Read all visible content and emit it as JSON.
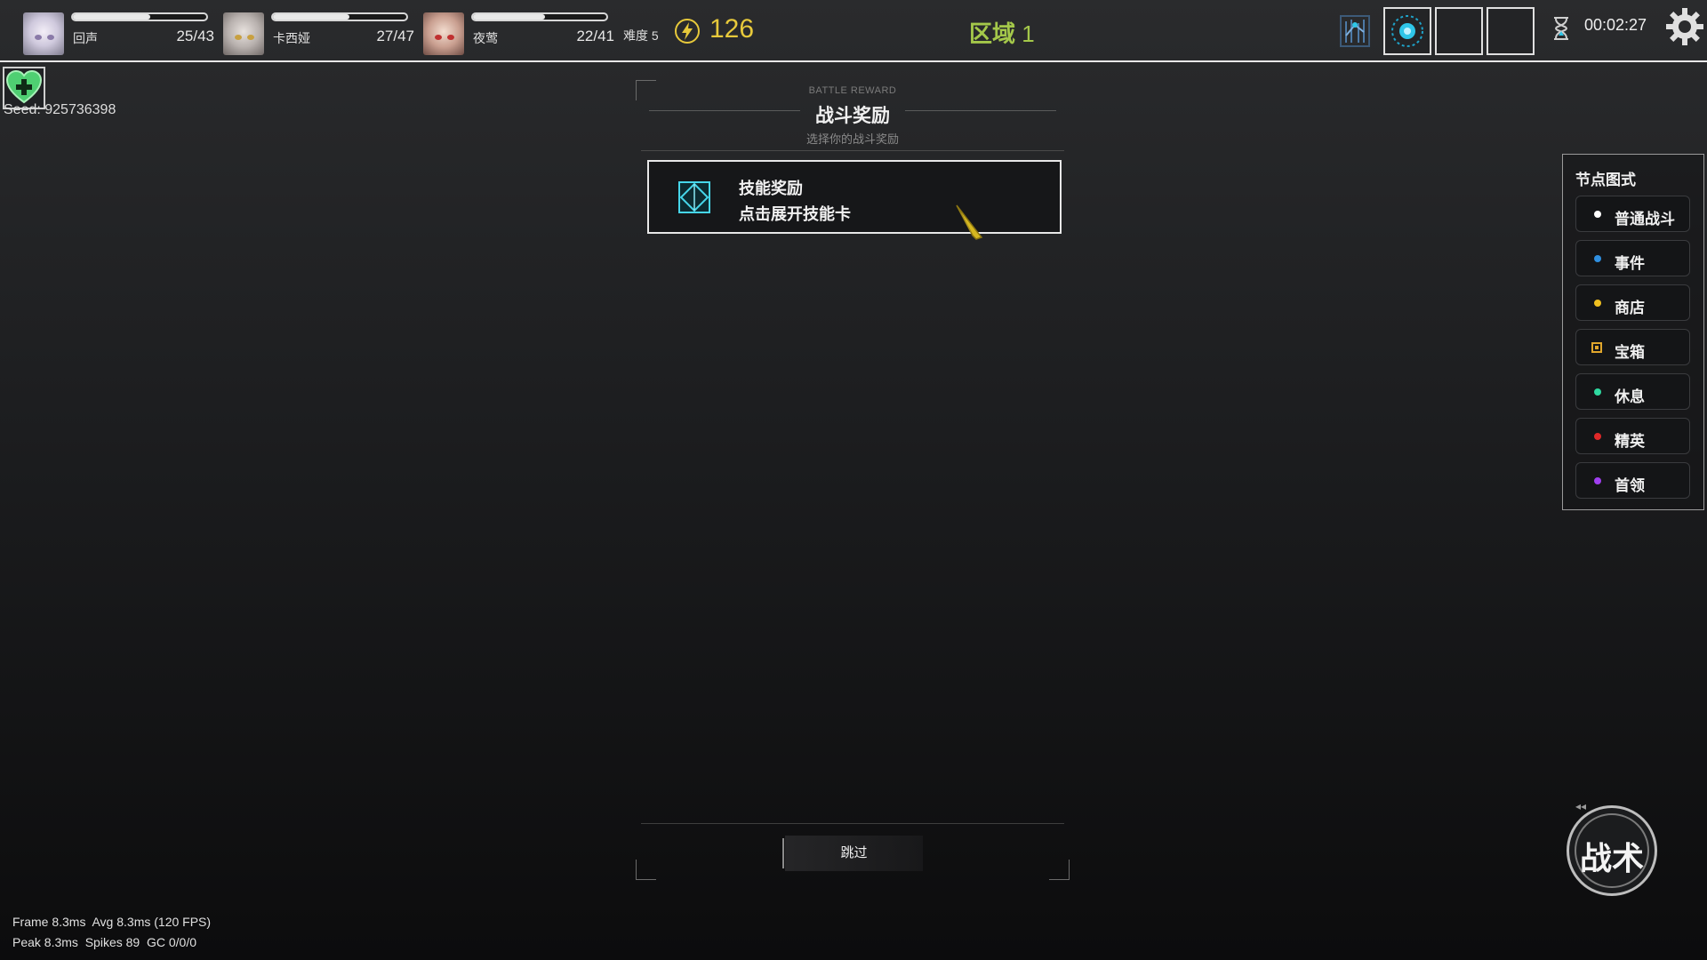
{
  "party": [
    {
      "name": "回声",
      "hp": "25/43",
      "hp_fraction": 0.58,
      "portrait_color": "#c9c6d8"
    },
    {
      "name": "卡西娅",
      "hp": "27/47",
      "hp_fraction": 0.57,
      "portrait_color": "#b8b1ae"
    },
    {
      "name": "夜莺",
      "hp": "22/41",
      "hp_fraction": 0.54,
      "portrait_color": "#c99f90"
    }
  ],
  "status": {
    "difficulty": "难度 5",
    "energy": "126",
    "zone_label": "区域",
    "zone_number": "1",
    "timer": "00:02:27"
  },
  "seed": "Seed: 925736398",
  "reward": {
    "header_en": "BATTLE REWARD",
    "title": "战斗奖励",
    "subtitle": "选择你的战斗奖励",
    "card_title": "技能奖励",
    "card_desc": "点击展开技能卡",
    "skip": "跳过"
  },
  "legend": {
    "title": "节点图式",
    "items": [
      {
        "label": "普通战斗",
        "color": "#ffffff",
        "shape": "dot"
      },
      {
        "label": "事件",
        "color": "#2f8fe0",
        "shape": "dot"
      },
      {
        "label": "商店",
        "color": "#f0c020",
        "shape": "dot"
      },
      {
        "label": "宝箱",
        "color": "#e0a62c",
        "shape": "square"
      },
      {
        "label": "休息",
        "color": "#2fd9a0",
        "shape": "dot"
      },
      {
        "label": "精英",
        "color": "#e02828",
        "shape": "dot"
      },
      {
        "label": "首领",
        "color": "#a03ff0",
        "shape": "dot"
      }
    ]
  },
  "tactics": {
    "label": "战术"
  },
  "perf": {
    "line1": "Frame 8.3ms  Avg 8.3ms (120 FPS)",
    "line2": "Peak 8.3ms  Spikes 89  GC 0/0/0"
  },
  "colors": {
    "energy": "#e7c93b",
    "zone": "#a4c84a",
    "accent_cyan": "#2fc6e8"
  }
}
